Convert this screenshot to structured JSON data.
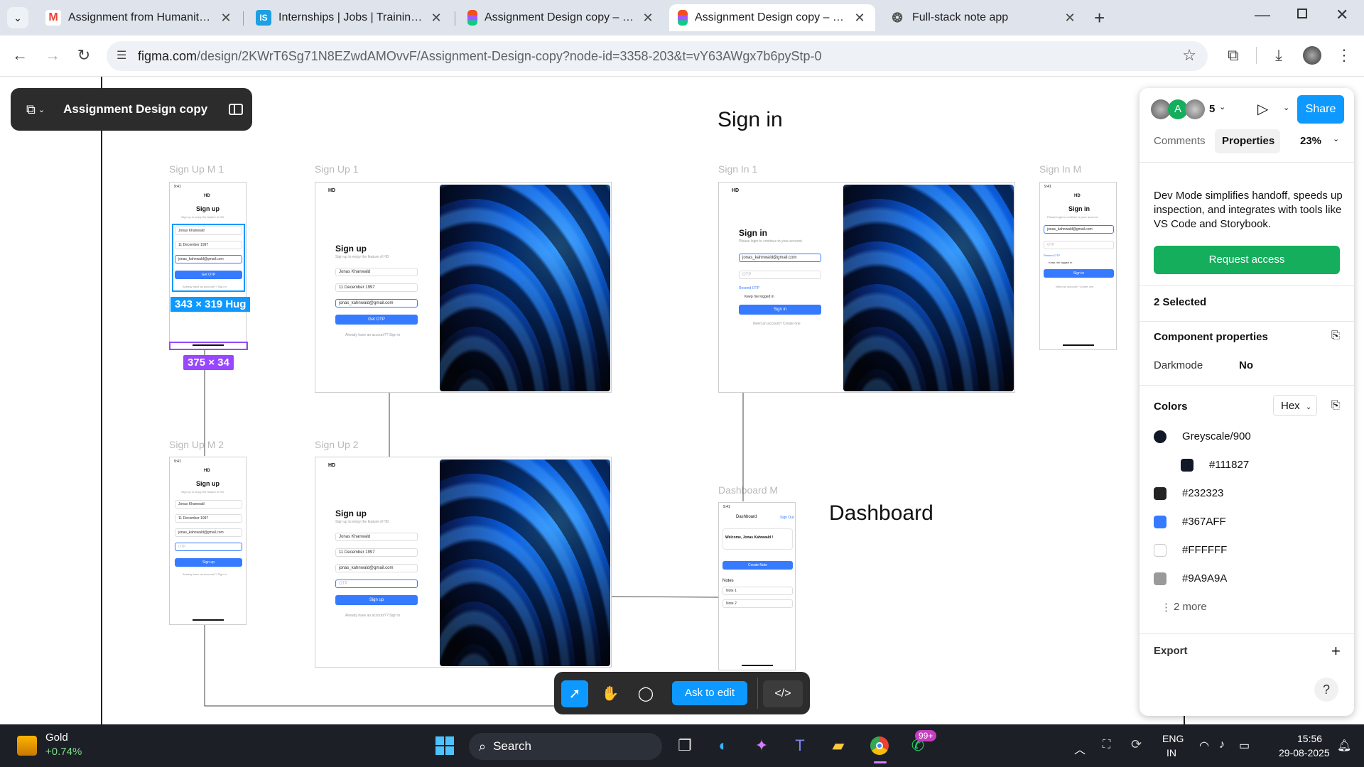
{
  "browser": {
    "tabs": [
      {
        "title": "Assignment from Humanity Fou",
        "icon": "gmail-icon"
      },
      {
        "title": "Internships | Jobs | Trainings & I",
        "icon": "internshala-icon"
      },
      {
        "title": "Assignment Design copy – Figm",
        "icon": "figma-icon"
      },
      {
        "title": "Assignment Design copy – Figm",
        "icon": "figma-icon"
      },
      {
        "title": "Full-stack note app",
        "icon": "openai-icon"
      }
    ],
    "url_host": "figma.com",
    "url_path": "/design/2KWrT6Sg71N8EZwdAMOvvF/Assignment-Design-copy?node-id=3358-203&t=vY63AWgx7b6pyStp-0"
  },
  "figma": {
    "file_name": "Assignment Design copy",
    "canvas": {
      "section_signin_title": "Sign in",
      "section_dashboard_title": "Dashboard",
      "frame_labels": {
        "signup_m1": "Sign Up M 1",
        "signup_1": "Sign Up 1",
        "signin_1": "Sign In 1",
        "signin_m": "Sign In M",
        "signup_m2": "Sign Up M 2",
        "signup_2": "Sign Up 2",
        "dashboard_m": "Dashboard M"
      },
      "size_badge_1": "343 × 319 Hug",
      "size_badge_2": "375 × 34",
      "mock": {
        "logo": "HD",
        "signup": "Sign up",
        "signin": "Sign in",
        "signup_sub": "Sign up to enjoy the feature of HD",
        "signin_sub": "Please login to continue to your account.",
        "name": "Jonas Khanwald",
        "dob": "11 December 1997",
        "email": "jonas_kahnwald@gmail.com",
        "otp": "OTP",
        "get_otp": "Get OTP",
        "already": "Already have an account?? Sign in",
        "resend": "Resend OTP",
        "keep": "Keep me logged in",
        "need": "Need an account? Create one",
        "dashboard": "Dashboard",
        "signout": "Sign Out",
        "welcome": "Welcome, Jonas Kahnwald !",
        "create_note": "Create Note",
        "notes": "Notes",
        "note1": "Note 1",
        "note2": "Note 2",
        "time": "9:41"
      }
    },
    "panel": {
      "collaborator_count": "5",
      "share": "Share",
      "tab_comments": "Comments",
      "tab_properties": "Properties",
      "zoom": "23%",
      "dev_mode_text": "Dev Mode simplifies handoff, speeds up inspection, and integrates with tools like VS Code and Storybook.",
      "request_access": "Request access",
      "selected": "2 Selected",
      "component_properties": "Component properties",
      "darkmode_label": "Darkmode",
      "darkmode_value": "No",
      "colors": "Colors",
      "color_format": "Hex",
      "color_items": [
        {
          "label": "Greyscale/900",
          "color": "#111827"
        },
        {
          "label": "#111827",
          "color": "#111827"
        },
        {
          "label": "#232323",
          "color": "#232323"
        },
        {
          "label": "#367AFF",
          "color": "#367AFF"
        },
        {
          "label": "#FFFFFF",
          "color": "#FFFFFF"
        },
        {
          "label": "#9A9A9A",
          "color": "#9A9A9A"
        }
      ],
      "more": "2 more",
      "export": "Export",
      "help": "?"
    },
    "toolbar": {
      "ask_to_edit": "Ask to edit"
    }
  },
  "taskbar": {
    "widget_title": "Gold",
    "widget_value": "+0.74%",
    "search": "Search",
    "notif_badge": "99+",
    "lang": "ENG",
    "region": "IN",
    "time": "15:56",
    "date": "29-08-2025"
  },
  "colors": {
    "accent": "#0d99ff",
    "figma_dark": "#2c2c2c",
    "purple": "#9747ff",
    "blue": "#367AFF",
    "green": "#14ae5c"
  }
}
